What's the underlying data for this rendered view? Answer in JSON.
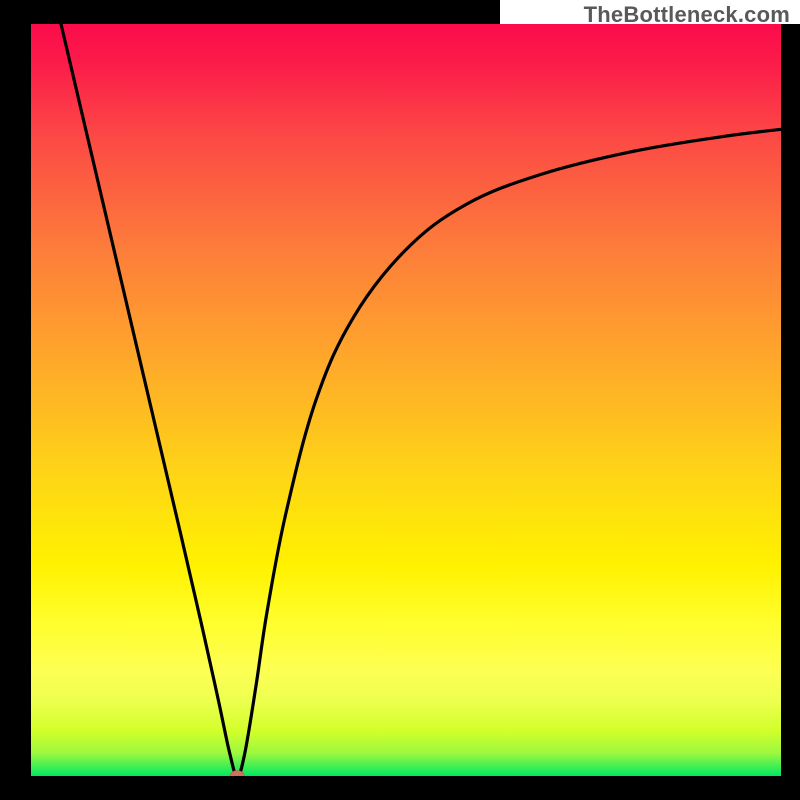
{
  "watermark": "TheBottleneck.com",
  "chart_data": {
    "type": "line",
    "title": "",
    "xlabel": "",
    "ylabel": "",
    "xlim": [
      0,
      100
    ],
    "ylim": [
      0,
      100
    ],
    "categories_note": "No visible axis tick labels; values estimated from pixel positions on a 100×100 normalized range.",
    "series": [
      {
        "name": "curve",
        "x": [
          4,
          8,
          12,
          16,
          20,
          23,
          25,
          26.5,
          27.5,
          28.5,
          30,
          31.5,
          34,
          38,
          43,
          50,
          58,
          68,
          80,
          92,
          100
        ],
        "values": [
          100,
          83,
          66,
          49,
          32,
          19,
          10,
          3,
          0,
          3,
          12,
          22,
          35,
          50,
          61,
          70,
          76,
          80,
          83,
          85,
          86
        ]
      }
    ],
    "marker": {
      "name": "minimum-dot",
      "x": 27.5,
      "y": 0,
      "radius": 6,
      "color": "#d0705e"
    },
    "background_gradient": {
      "top_color": "#fb0c4b",
      "mid_colors": [
        "#fea229",
        "#fff200",
        "#fdff53",
        "#d2ff2a"
      ],
      "bottom_color": "#00e763"
    },
    "axes": {
      "color": "#000000",
      "thickness_px": 20
    }
  }
}
